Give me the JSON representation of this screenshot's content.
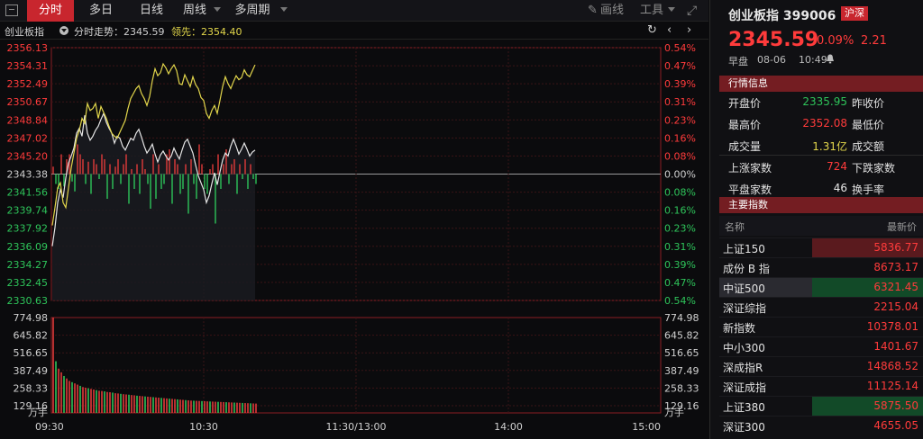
{
  "toolbar": {
    "tabs": [
      "分时",
      "多日",
      "日线",
      "周线",
      "多周期"
    ],
    "draw_label": "画线",
    "tools_label": "工具"
  },
  "subbar": {
    "index_name": "创业板指",
    "series1": "分时走势：2345.59",
    "series2": "领先：2354.40"
  },
  "chart_data": {
    "type": "line",
    "price_ticks_left": [
      "2356.13",
      "2354.31",
      "2352.49",
      "2350.67",
      "2348.84",
      "2347.02",
      "2345.20",
      "2343.38",
      "2341.56",
      "2339.74",
      "2337.92",
      "2336.09",
      "2334.27",
      "2332.45",
      "2330.63"
    ],
    "pct_ticks_right": [
      "0.54%",
      "0.47%",
      "0.39%",
      "0.31%",
      "0.23%",
      "0.16%",
      "0.08%",
      "0.00%",
      "0.08%",
      "0.16%",
      "0.23%",
      "0.31%",
      "0.39%",
      "0.47%",
      "0.54%"
    ],
    "volume_ticks": [
      "774.98",
      "645.82",
      "516.65",
      "387.49",
      "258.33",
      "129.16"
    ],
    "volume_unit": "万手",
    "time_ticks": [
      "09:30",
      "10:30",
      "11:30/13:00",
      "14:00",
      "15:00"
    ],
    "prev_close": 2343.38,
    "price_range": [
      2330.63,
      2356.13
    ],
    "volume_max": 774.98,
    "series": [
      {
        "name": "分时走势",
        "color": "#e6e6e6",
        "values": [
          2336.1,
          2338,
          2340.5,
          2341.8,
          2341,
          2343,
          2344.5,
          2345.2,
          2346,
          2347.5,
          2348,
          2347.2,
          2349.3,
          2347.5,
          2346.8,
          2347.2,
          2347.8,
          2348.2,
          2348.9,
          2349.5,
          2348.6,
          2348,
          2347.5,
          2346.5,
          2347.2,
          2347,
          2346.2,
          2345.8,
          2346.4,
          2347,
          2346.8,
          2347.5,
          2347.9,
          2347.1,
          2346.2,
          2345.5,
          2345.9,
          2346.4,
          2345.4,
          2344.6,
          2345.3,
          2345.7,
          2345.2,
          2344.8,
          2345.2,
          2346,
          2345.4,
          2344.9,
          2345.8,
          2346.6,
          2346.9,
          2346.2,
          2345.5,
          2344.3,
          2343.2,
          2342.5,
          2341.8,
          2340.5,
          2341.2,
          2342.4,
          2343.5,
          2342.3,
          2343.6,
          2344.8,
          2345.5,
          2345.2,
          2346.2,
          2346.9,
          2346.2,
          2345.4,
          2345.9,
          2346.5,
          2345.9,
          2345.2,
          2345.6,
          2345.8
        ]
      },
      {
        "name": "领先",
        "color": "#e2d64b",
        "values": [
          2338.2,
          2340,
          2342,
          2342.5,
          2340.5,
          2340,
          2342,
          2344,
          2345.5,
          2347,
          2347.8,
          2349,
          2348.5,
          2350.5,
          2349.8,
          2350,
          2350.5,
          2349,
          2350.2,
          2349.6,
          2349,
          2348.2,
          2347.5,
          2347.2,
          2347,
          2347.6,
          2348.2,
          2348.8,
          2350,
          2351,
          2351.5,
          2352,
          2352.3,
          2351.5,
          2351,
          2350.3,
          2351.2,
          2352.8,
          2354,
          2353.3,
          2353.6,
          2354.5,
          2354.1,
          2353.5,
          2354,
          2354.4,
          2353.8,
          2352.5,
          2352.4,
          2353.4,
          2352.8,
          2352.2,
          2353.2,
          2352.4,
          2352,
          2351.1,
          2350.8,
          2349.5,
          2349,
          2349.8,
          2350.3,
          2349.5,
          2350.8,
          2352.2,
          2353.2,
          2352.5,
          2352,
          2352.7,
          2353.3,
          2352.9,
          2353.1,
          2353.9,
          2353.4,
          2353.2,
          2353.8,
          2354.4
        ]
      }
    ],
    "diff_bars": [
      1.5,
      -2,
      -3,
      4,
      -2.5,
      3,
      4,
      -1.5,
      -3.5,
      6,
      4,
      3,
      -2,
      2.5,
      -4,
      3,
      2,
      -1,
      4,
      3,
      -5,
      2,
      -3,
      1.5,
      3,
      -2,
      2,
      4,
      -6,
      1,
      -3,
      2,
      -4,
      3,
      1,
      -2,
      -7,
      4,
      -5,
      2,
      -3,
      -2,
      4,
      5,
      -6,
      3,
      2,
      -4,
      -3,
      2,
      -8,
      3,
      -2,
      -5,
      6,
      2,
      -3,
      -4,
      1,
      2,
      -10,
      4,
      -3,
      2,
      5,
      -2,
      2,
      3,
      -4,
      2,
      -1,
      3,
      -3,
      2,
      -1,
      -2
    ],
    "volume": [
      774.98,
      420,
      360,
      330,
      300,
      280,
      260,
      250,
      240,
      230,
      220,
      210,
      205,
      200,
      195,
      190,
      185,
      180,
      178,
      175,
      170,
      168,
      165,
      160,
      158,
      155,
      152,
      150,
      148,
      145,
      143,
      140,
      138,
      136,
      134,
      132,
      130,
      128,
      126,
      124,
      122,
      120,
      118,
      116,
      114,
      112,
      110,
      108,
      106,
      104,
      102,
      100,
      99,
      98,
      97,
      96,
      95,
      94,
      93,
      92,
      91,
      90,
      89,
      88,
      87,
      86,
      85,
      84,
      83,
      82,
      81,
      80,
      79,
      78,
      77,
      76
    ]
  },
  "quote": {
    "name": "创业板指 399006",
    "market_badge": "沪深",
    "price": "2345.59",
    "pct": "0.09%",
    "change": "2.21",
    "session": "早盘",
    "date": "08-06",
    "time": "10:49",
    "section_info": "行情信息",
    "open_label": "开盘价",
    "open_value": "2335.95",
    "prev_close_label": "昨收价",
    "high_label": "最高价",
    "high_value": "2352.08",
    "low_label": "最低价",
    "volume_label": "成交量",
    "volume_value": "1.31亿",
    "amount_label": "成交额",
    "up_label": "上涨家数",
    "up_value": "724",
    "down_label": "下跌家数",
    "flat_label": "平盘家数",
    "flat_value": "46",
    "turnover_label": "换手率",
    "section_index": "主要指数",
    "col_name": "名称",
    "col_price": "最新价",
    "indices": [
      {
        "name": "上证150",
        "price": "5836.77"
      },
      {
        "name": "成份 B 指",
        "price": "8673.17"
      },
      {
        "name": "中证500",
        "price": "6321.45"
      },
      {
        "name": "深证综指",
        "price": "2215.04"
      },
      {
        "name": "新指数",
        "price": "10378.01"
      },
      {
        "name": "中小300",
        "price": "1401.67"
      },
      {
        "name": "深成指R",
        "price": "14868.52"
      },
      {
        "name": "深证成指",
        "price": "11125.14"
      },
      {
        "name": "上证380",
        "price": "5875.50"
      },
      {
        "name": "深证300",
        "price": "4655.05"
      }
    ]
  }
}
